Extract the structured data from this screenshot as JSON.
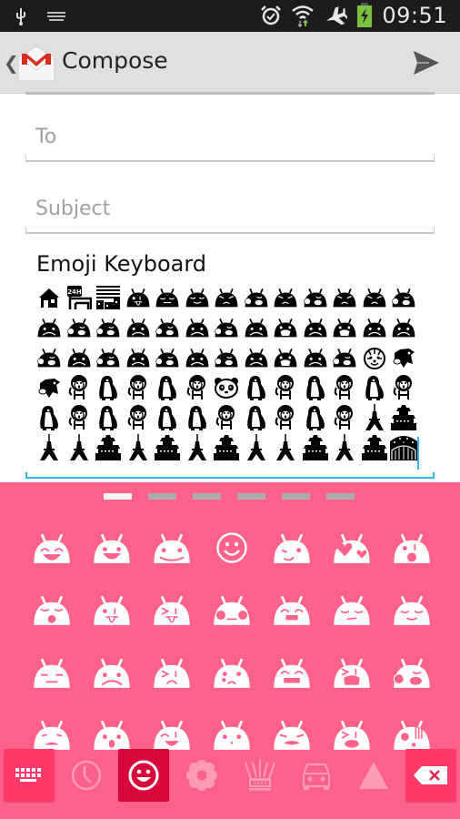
{
  "status_bar": {
    "time": "09:51",
    "left_icons": [
      "usb-icon",
      "keyboard-icon"
    ],
    "right_icons": [
      "alarm-icon",
      "wifi-icon",
      "airplane-mode-icon",
      "battery-charging-icon"
    ],
    "battery_color": "#7cc242"
  },
  "action_bar": {
    "title": "Compose",
    "back_glyph": "❮",
    "logo": "gmail-logo",
    "send_action": "send-icon"
  },
  "form": {
    "to": {
      "placeholder": "To",
      "value": ""
    },
    "subject": {
      "placeholder": "Subject",
      "value": ""
    },
    "body": {
      "text": "Emoji Keyboard",
      "emoji_rows": [
        [
          "house",
          "convenience-store",
          "office-building",
          "droid-tongue",
          "droid-sleepy",
          "droid-content",
          "droid-angry",
          "droid-puff",
          "droid-angry",
          "droid-puff",
          "droid-angry",
          "droid-angry",
          "droid-puff"
        ],
        [
          "droid-sad",
          "droid-puff",
          "droid-puff",
          "droid-sad",
          "droid-puff",
          "droid-sad",
          "droid-puff",
          "droid-sad",
          "droid-cry",
          "droid-sad",
          "droid-cry",
          "droid-sad",
          "droid-sad"
        ],
        [
          "droid-puff",
          "droid-sad",
          "droid-puff",
          "droid-sad",
          "droid-puff",
          "droid-sad",
          "droid-puff",
          "droid-sad",
          "droid-cry",
          "droid-sad",
          "droid-puff",
          "tiger",
          "cow"
        ],
        [
          "cow",
          "monkey",
          "penguin",
          "monkey",
          "penguin",
          "monkey",
          "panda",
          "penguin",
          "monkey",
          "penguin",
          "monkey",
          "penguin",
          "monkey"
        ],
        [
          "penguin",
          "monkey",
          "penguin",
          "monkey",
          "penguin",
          "penguin",
          "monkey",
          "penguin",
          "monkey",
          "penguin",
          "monkey",
          "tokyo-tower",
          "castle"
        ],
        [
          "tokyo-tower",
          "tokyo-tower",
          "castle",
          "tokyo-tower",
          "castle",
          "tokyo-tower",
          "castle",
          "tokyo-tower",
          "tokyo-tower",
          "castle",
          "tokyo-tower",
          "castle",
          "night-bridge"
        ]
      ]
    }
  },
  "keyboard": {
    "background": "#fe6189",
    "pages": 6,
    "active_page": 1,
    "grid": [
      [
        "droid-laugh",
        "droid-grin",
        "droid-smile",
        "smiley-outline",
        "droid-wink",
        "droid-heart-eyes",
        "droid-kiss-wink"
      ],
      [
        "droid-kiss",
        "droid-tongue-wink",
        "droid-tongue-squint",
        "droid-blush",
        "droid-teeth",
        "droid-unamused",
        "droid-relieved"
      ],
      [
        "droid-meh",
        "droid-worried",
        "droid-squint",
        "droid-tear",
        "droid-grimace",
        "droid-crying",
        "droid-puff"
      ],
      [
        "droid-disappointed",
        "droid-surprised",
        "droid-happy-squint",
        "droid-neutral",
        "droid-tired",
        "droid-scream-squint",
        "droid-shock"
      ]
    ],
    "toolbar": [
      {
        "name": "keyboard-switch",
        "icon": "keyboard-icon"
      },
      {
        "name": "recent",
        "icon": "clock-icon"
      },
      {
        "name": "faces",
        "icon": "smiley-icon",
        "active": true
      },
      {
        "name": "nature",
        "icon": "flower-icon"
      },
      {
        "name": "objects",
        "icon": "crown-icon"
      },
      {
        "name": "places",
        "icon": "car-icon"
      },
      {
        "name": "symbols",
        "icon": "triangle-icon"
      },
      {
        "name": "backspace",
        "icon": "backspace-icon"
      }
    ],
    "accent_active": "#d8063a",
    "accent_button": "#fe3a6a"
  }
}
